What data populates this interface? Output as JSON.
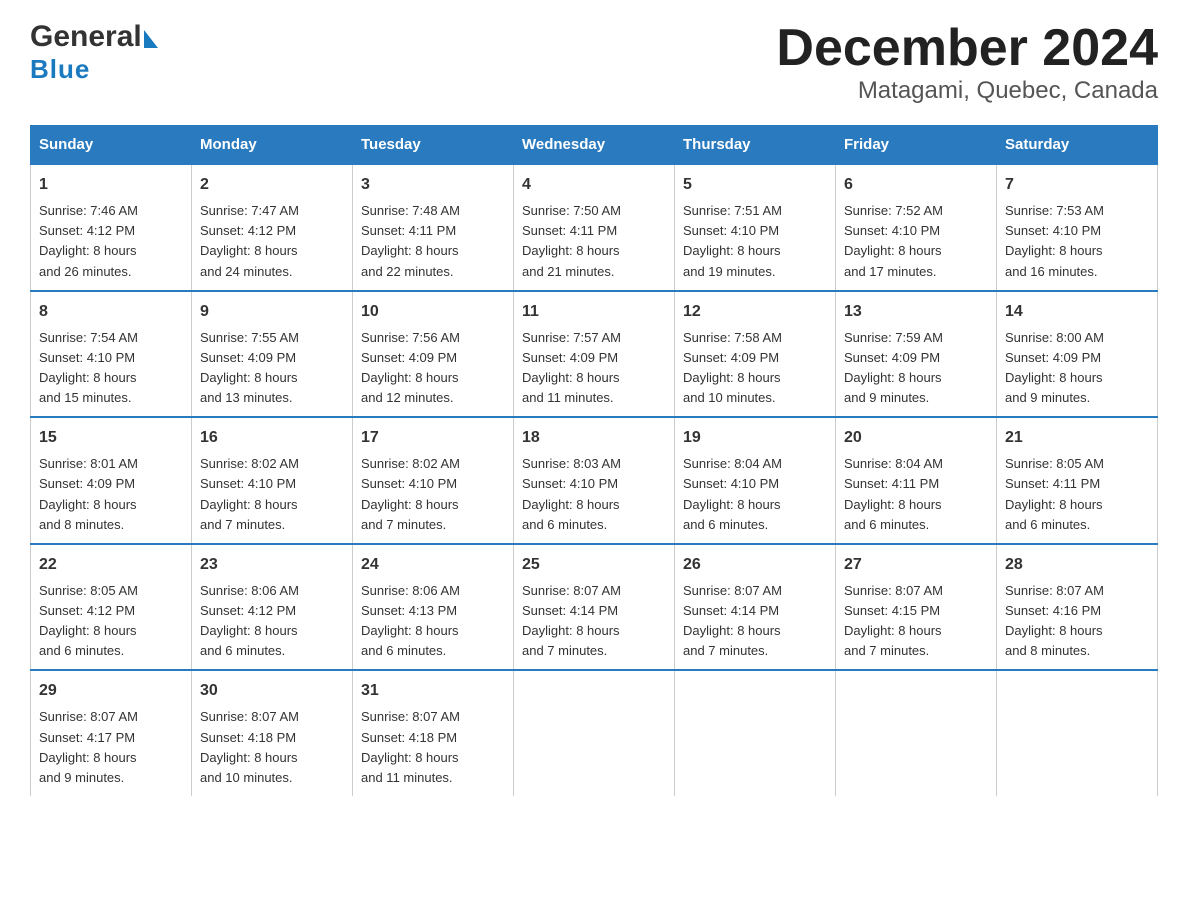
{
  "logo": {
    "general": "General",
    "blue": "Blue",
    "arrow": "▶"
  },
  "title": "December 2024",
  "subtitle": "Matagami, Quebec, Canada",
  "days": [
    "Sunday",
    "Monday",
    "Tuesday",
    "Wednesday",
    "Thursday",
    "Friday",
    "Saturday"
  ],
  "weeks": [
    [
      {
        "date": "1",
        "sunrise": "7:46 AM",
        "sunset": "4:12 PM",
        "daylight": "8 hours and 26 minutes."
      },
      {
        "date": "2",
        "sunrise": "7:47 AM",
        "sunset": "4:12 PM",
        "daylight": "8 hours and 24 minutes."
      },
      {
        "date": "3",
        "sunrise": "7:48 AM",
        "sunset": "4:11 PM",
        "daylight": "8 hours and 22 minutes."
      },
      {
        "date": "4",
        "sunrise": "7:50 AM",
        "sunset": "4:11 PM",
        "daylight": "8 hours and 21 minutes."
      },
      {
        "date": "5",
        "sunrise": "7:51 AM",
        "sunset": "4:10 PM",
        "daylight": "8 hours and 19 minutes."
      },
      {
        "date": "6",
        "sunrise": "7:52 AM",
        "sunset": "4:10 PM",
        "daylight": "8 hours and 17 minutes."
      },
      {
        "date": "7",
        "sunrise": "7:53 AM",
        "sunset": "4:10 PM",
        "daylight": "8 hours and 16 minutes."
      }
    ],
    [
      {
        "date": "8",
        "sunrise": "7:54 AM",
        "sunset": "4:10 PM",
        "daylight": "8 hours and 15 minutes."
      },
      {
        "date": "9",
        "sunrise": "7:55 AM",
        "sunset": "4:09 PM",
        "daylight": "8 hours and 13 minutes."
      },
      {
        "date": "10",
        "sunrise": "7:56 AM",
        "sunset": "4:09 PM",
        "daylight": "8 hours and 12 minutes."
      },
      {
        "date": "11",
        "sunrise": "7:57 AM",
        "sunset": "4:09 PM",
        "daylight": "8 hours and 11 minutes."
      },
      {
        "date": "12",
        "sunrise": "7:58 AM",
        "sunset": "4:09 PM",
        "daylight": "8 hours and 10 minutes."
      },
      {
        "date": "13",
        "sunrise": "7:59 AM",
        "sunset": "4:09 PM",
        "daylight": "8 hours and 9 minutes."
      },
      {
        "date": "14",
        "sunrise": "8:00 AM",
        "sunset": "4:09 PM",
        "daylight": "8 hours and 9 minutes."
      }
    ],
    [
      {
        "date": "15",
        "sunrise": "8:01 AM",
        "sunset": "4:09 PM",
        "daylight": "8 hours and 8 minutes."
      },
      {
        "date": "16",
        "sunrise": "8:02 AM",
        "sunset": "4:10 PM",
        "daylight": "8 hours and 7 minutes."
      },
      {
        "date": "17",
        "sunrise": "8:02 AM",
        "sunset": "4:10 PM",
        "daylight": "8 hours and 7 minutes."
      },
      {
        "date": "18",
        "sunrise": "8:03 AM",
        "sunset": "4:10 PM",
        "daylight": "8 hours and 6 minutes."
      },
      {
        "date": "19",
        "sunrise": "8:04 AM",
        "sunset": "4:10 PM",
        "daylight": "8 hours and 6 minutes."
      },
      {
        "date": "20",
        "sunrise": "8:04 AM",
        "sunset": "4:11 PM",
        "daylight": "8 hours and 6 minutes."
      },
      {
        "date": "21",
        "sunrise": "8:05 AM",
        "sunset": "4:11 PM",
        "daylight": "8 hours and 6 minutes."
      }
    ],
    [
      {
        "date": "22",
        "sunrise": "8:05 AM",
        "sunset": "4:12 PM",
        "daylight": "8 hours and 6 minutes."
      },
      {
        "date": "23",
        "sunrise": "8:06 AM",
        "sunset": "4:12 PM",
        "daylight": "8 hours and 6 minutes."
      },
      {
        "date": "24",
        "sunrise": "8:06 AM",
        "sunset": "4:13 PM",
        "daylight": "8 hours and 6 minutes."
      },
      {
        "date": "25",
        "sunrise": "8:07 AM",
        "sunset": "4:14 PM",
        "daylight": "8 hours and 7 minutes."
      },
      {
        "date": "26",
        "sunrise": "8:07 AM",
        "sunset": "4:14 PM",
        "daylight": "8 hours and 7 minutes."
      },
      {
        "date": "27",
        "sunrise": "8:07 AM",
        "sunset": "4:15 PM",
        "daylight": "8 hours and 7 minutes."
      },
      {
        "date": "28",
        "sunrise": "8:07 AM",
        "sunset": "4:16 PM",
        "daylight": "8 hours and 8 minutes."
      }
    ],
    [
      {
        "date": "29",
        "sunrise": "8:07 AM",
        "sunset": "4:17 PM",
        "daylight": "8 hours and 9 minutes."
      },
      {
        "date": "30",
        "sunrise": "8:07 AM",
        "sunset": "4:18 PM",
        "daylight": "8 hours and 10 minutes."
      },
      {
        "date": "31",
        "sunrise": "8:07 AM",
        "sunset": "4:18 PM",
        "daylight": "8 hours and 11 minutes."
      },
      null,
      null,
      null,
      null
    ]
  ],
  "labels": {
    "sunrise": "Sunrise:",
    "sunset": "Sunset:",
    "daylight": "Daylight:"
  }
}
